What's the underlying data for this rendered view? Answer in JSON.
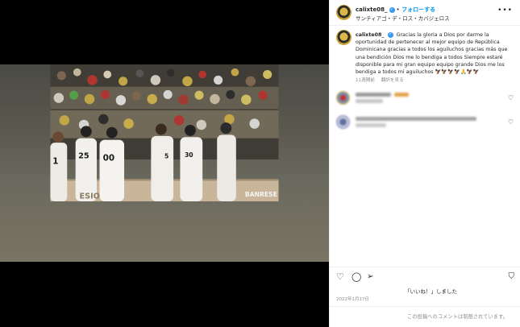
{
  "post": {
    "username": "calixte08_",
    "follow_label": "フォローする",
    "location": "サンティアゴ・デ・ロス・カバジェロス",
    "caption_user": "calixte08_",
    "caption_text": "Gracias la gloria a Dios por darme la oportunidad de pertenecer al mejor equipo de República Dominicana gracias a todos los aguiluchos gracias más que una bendición Dios me lo bendiga a todos Siempre estaré disponible para mi gran equipo equipo grande Dios me los bendiga a todos mi aguiluchos 🦅🦅🦅🦅🙏🦅🦅",
    "caption_age": "11週間前",
    "translate_label": "翻訳を見る",
    "likes_label": "「いいね！」しました",
    "date": "2022年1月17日",
    "comments_disabled": "この投稿へのコメントは制限されています。",
    "more_label": "•••"
  },
  "photo": {
    "sign_text": "BANRESE",
    "sign_left": "ESIO",
    "jersey_numbers": [
      "1",
      "25",
      "00",
      "5",
      "30"
    ]
  },
  "colors": {
    "accent": "#0095f6",
    "verified": "#3897f0",
    "muted": "#8e8e8e"
  },
  "icons": [
    "more-icon",
    "verified-icon",
    "heart-icon",
    "comment-icon",
    "share-icon",
    "bookmark-icon",
    "user-tag-icon"
  ]
}
